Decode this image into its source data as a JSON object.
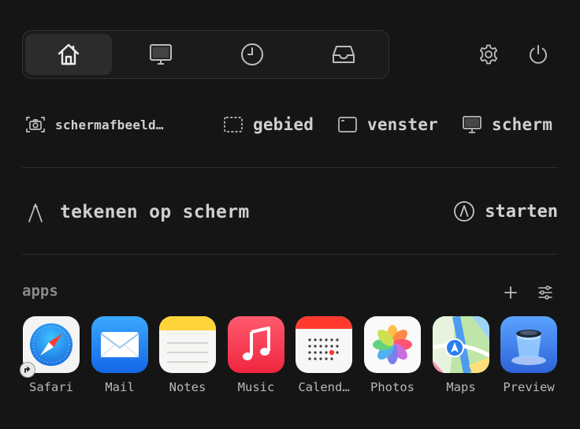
{
  "toolbar": {
    "tabs": [
      {
        "name": "home",
        "icon": "home-icon",
        "active": true
      },
      {
        "name": "display",
        "icon": "display-icon",
        "active": false
      },
      {
        "name": "history",
        "icon": "clock-icon",
        "active": false
      },
      {
        "name": "inbox",
        "icon": "inbox-icon",
        "active": false
      }
    ],
    "settings_icon": "gear-icon",
    "power_icon": "power-icon"
  },
  "capture": {
    "screenshot_label": "schermafbeeld…",
    "area_label": "gebied",
    "window_label": "venster",
    "screen_label": "scherm"
  },
  "draw": {
    "label": "tekenen op scherm",
    "start_label": "starten"
  },
  "apps": {
    "title": "apps",
    "items": [
      {
        "label": "Safari"
      },
      {
        "label": "Mail"
      },
      {
        "label": "Notes"
      },
      {
        "label": "Music"
      },
      {
        "label": "Calend…"
      },
      {
        "label": "Photos"
      },
      {
        "label": "Maps"
      },
      {
        "label": "Preview"
      }
    ]
  },
  "colors": {
    "background": "#151515",
    "text": "#cfcfcf",
    "muted": "#8a8a8a"
  }
}
